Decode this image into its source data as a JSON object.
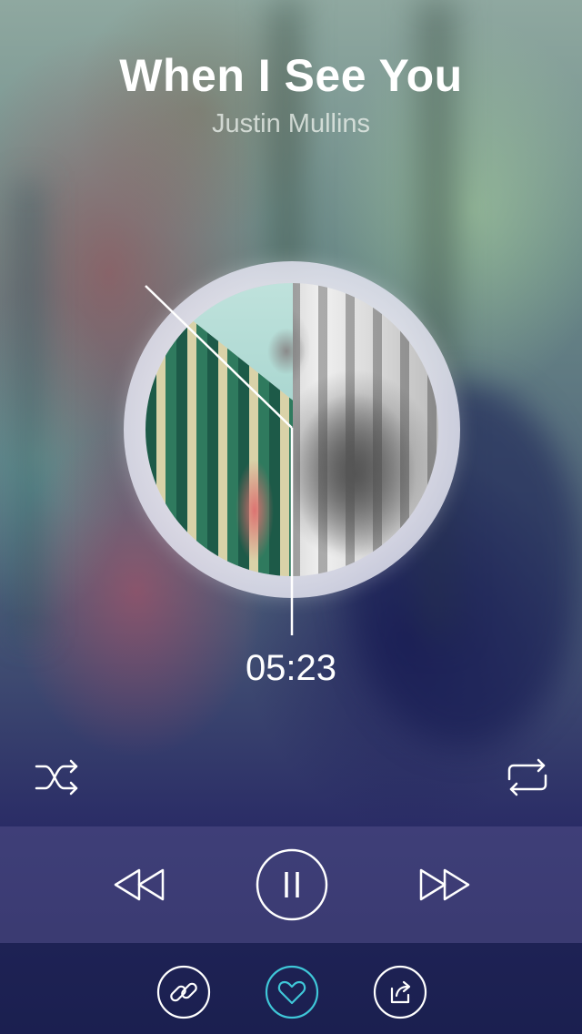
{
  "song": {
    "title": "When I See You",
    "artist": "Justin Mullins"
  },
  "player": {
    "time": "05:23",
    "state": "playing"
  },
  "icons": {
    "shuffle": "shuffle-icon",
    "repeat": "repeat-icon",
    "rewind": "rewind-icon",
    "pause": "pause-icon",
    "forward": "fast-forward-icon",
    "link": "link-icon",
    "favorite": "heart-icon",
    "share": "share-icon"
  },
  "colors": {
    "icon": "#ffffff",
    "favorite_accent": "#3fc7d8",
    "text": "#ffffff"
  }
}
